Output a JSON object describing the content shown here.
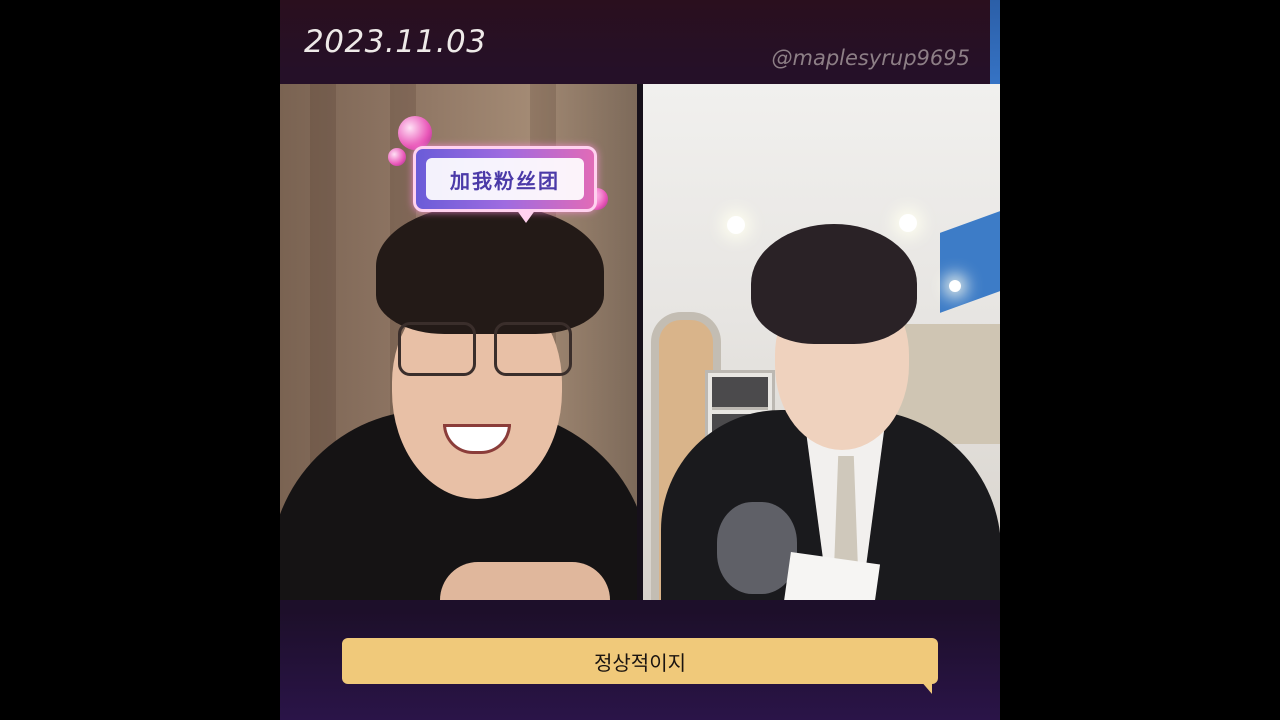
{
  "header": {
    "date": "2023.11.03",
    "handle": "@maplesyrup9695"
  },
  "left_panel": {
    "badge_text": "加我粉丝团"
  },
  "subtitle": {
    "text": "정상적이지"
  },
  "colors": {
    "subtitle_bg": "#f0c97a",
    "accent_blue": "#3a7bd0",
    "background": "#1d0f2a"
  }
}
